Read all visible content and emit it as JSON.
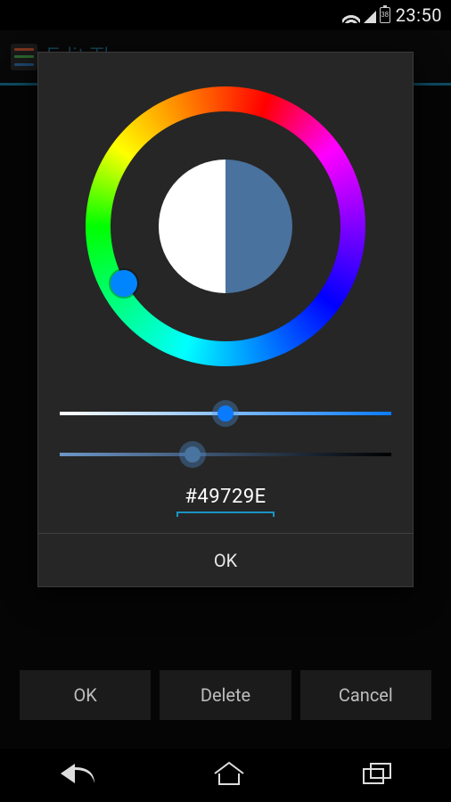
{
  "status": {
    "time": "23:50",
    "battery_label": "38"
  },
  "header": {
    "title": "Edit Theme"
  },
  "color_picker": {
    "selected_hex": "#49729E",
    "preview_left_color": "#FFFFFF",
    "preview_right_color": "#49729E",
    "hue_thumb_color": "#0085ff",
    "saturation_slider": {
      "value_pct": 50,
      "thumb_color": "#0a7bff",
      "track_gradient_from": "#ffffff",
      "track_gradient_to": "#0a7bff"
    },
    "value_slider": {
      "value_pct": 40,
      "thumb_color": "#4a74a0",
      "track_gradient_from": "#6d97c9",
      "track_gradient_to": "#000000"
    }
  },
  "dialog": {
    "confirm_label": "OK"
  },
  "back_buttons": {
    "ok": "OK",
    "delete": "Delete",
    "cancel": "Cancel"
  }
}
